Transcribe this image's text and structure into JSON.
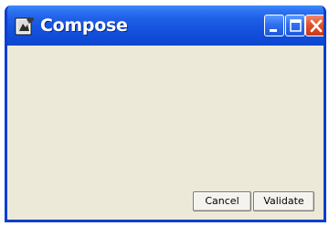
{
  "window": {
    "title": "Compose",
    "icon": "compose-app-icon",
    "titlebar_buttons": {
      "minimize": "minimize-icon",
      "maximize": "maximize-icon",
      "close": "close-icon"
    }
  },
  "footer": {
    "cancel_label": "Cancel",
    "validate_label": "Validate"
  },
  "colors": {
    "titlebar": "#1552de",
    "window_body": "#ece9d8",
    "close_button": "#e0532d"
  }
}
